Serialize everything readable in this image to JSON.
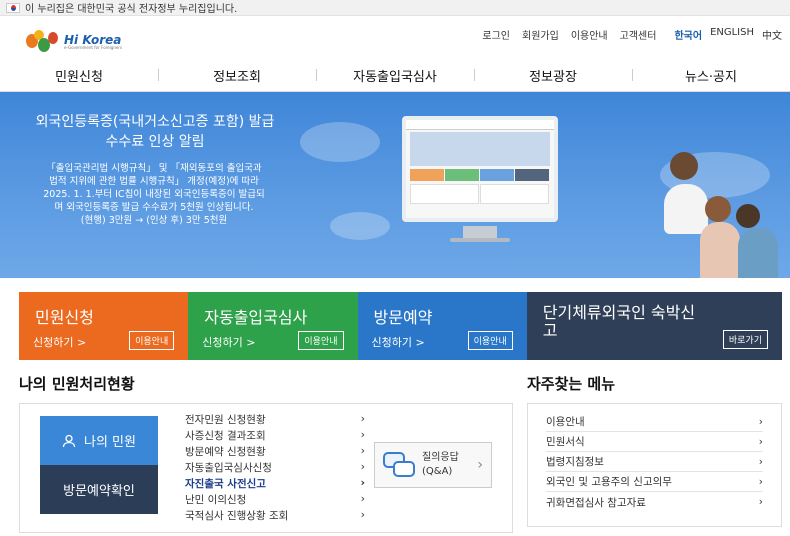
{
  "gov_notice": "이 누리집은 대한민국 공식 전자정부 누리집입니다.",
  "logo": {
    "text": "Hi Korea",
    "subtext": "e-Government for Foreigners"
  },
  "top_links": [
    "로그인",
    "회원가입",
    "이용안내",
    "고객센터"
  ],
  "languages": [
    {
      "label": "한국어",
      "active": true
    },
    {
      "label": "ENGLISH",
      "active": false
    },
    {
      "label": "中文",
      "active": false
    }
  ],
  "nav": [
    "민원신청",
    "정보조회",
    "자동출입국심사",
    "정보광장",
    "뉴스·공지"
  ],
  "banner": {
    "title_line1": "외국인등록증(국내거소신고증 포함) 발급",
    "title_line2": "수수료 인상 알림",
    "body_line1": "「출입국관리법 시행규칙」 및 「재외동포의 출입국과",
    "body_line2": "법적 지위에 관한 법률 시행규칙」 개정(예정)에 따라",
    "body_line3": "2025. 1. 1.부터 IC칩이 내장된 외국인등록증이 발급되",
    "body_line4": "며 외국인등록증 발급 수수료가 5천원 인상됩니다.",
    "body_line5": "(현행) 3만원 → (인상 후) 3만 5천원",
    "prev": "‹",
    "next": "›"
  },
  "services": [
    {
      "name": "민원신청",
      "apply": "신청하기 >",
      "button": "이용안내",
      "color": "#ec6a1f"
    },
    {
      "name": "자동출입국심사",
      "apply": "신청하기 >",
      "button": "이용안내",
      "color": "#2ea24a"
    },
    {
      "name": "방문예약",
      "apply": "신청하기 >",
      "button": "이용안내",
      "color": "#2a77c9"
    },
    {
      "name": "단기체류외국인 숙박신고",
      "apply": "",
      "button": "바로가기",
      "color": "#2f3f57"
    }
  ],
  "my_status": {
    "title": "나의 민원처리현황",
    "my_button": "나의 민원",
    "visit_button": "방문예약확인",
    "items": [
      {
        "label": "전자민원 신청현황",
        "bold": false
      },
      {
        "label": "사증신청 결과조회",
        "bold": false
      },
      {
        "label": "방문예약 신청현황",
        "bold": false
      },
      {
        "label": "자동출입국심사신청",
        "bold": false
      },
      {
        "label": "자진출국 사전신고",
        "bold": true
      },
      {
        "label": "난민 이의신청",
        "bold": false
      },
      {
        "label": "국적심사 진행상황 조회",
        "bold": false
      }
    ],
    "qa_line1": "질의응답",
    "qa_line2": "(Q&A)"
  },
  "faq": {
    "title": "자주찾는 메뉴",
    "items": [
      "이용안내",
      "민원서식",
      "법령지침정보",
      "외국인 및 고용주의 신고의무",
      "귀화면접심사 참고자료"
    ]
  }
}
